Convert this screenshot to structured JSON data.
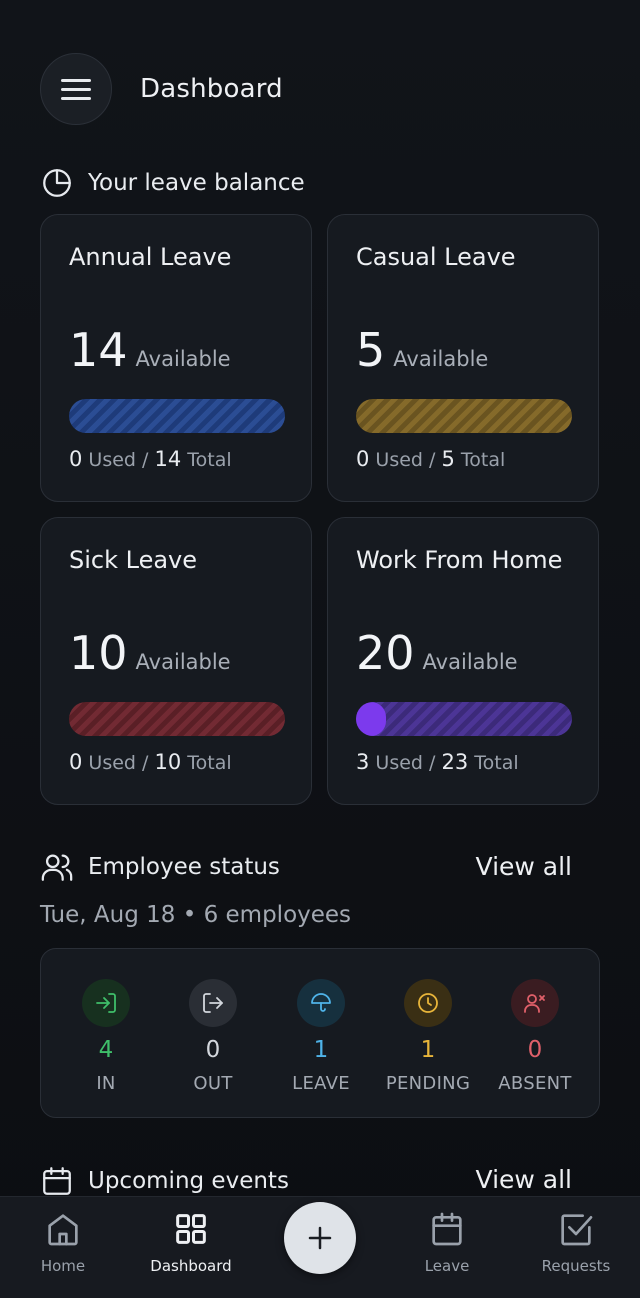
{
  "header": {
    "title": "Dashboard"
  },
  "leave_section": {
    "title": "Your leave balance"
  },
  "leave_cards": [
    {
      "title": "Annual Leave",
      "available": "14",
      "available_label": "Available",
      "used": "0",
      "used_label": "Used",
      "sep": "/",
      "total": "14",
      "total_label": "Total",
      "used_fraction": 0,
      "color": "#2b4d94"
    },
    {
      "title": "Casual Leave",
      "available": "5",
      "available_label": "Available",
      "used": "0",
      "used_label": "Used",
      "sep": "/",
      "total": "5",
      "total_label": "Total",
      "used_fraction": 0,
      "color": "#856a2a"
    },
    {
      "title": "Sick Leave",
      "available": "10",
      "available_label": "Available",
      "used": "0",
      "used_label": "Used",
      "sep": "/",
      "total": "10",
      "total_label": "Total",
      "used_fraction": 0,
      "color": "#722a33"
    },
    {
      "title": "Work From Home",
      "available": "20",
      "available_label": "Available",
      "used": "3",
      "used_label": "Used",
      "sep": "/",
      "total": "23",
      "total_label": "Total",
      "used_fraction": 0.13,
      "color": "#7c3aed"
    }
  ],
  "employee_section": {
    "title": "Employee status",
    "view_all": "View all",
    "subline": "Tue, Aug 18 • 6 employees",
    "stats": [
      {
        "label": "IN",
        "count": "4",
        "icon": "login-icon",
        "color": "#3fbf6a"
      },
      {
        "label": "OUT",
        "count": "0",
        "icon": "logout-icon",
        "color": "#c9ced6"
      },
      {
        "label": "LEAVE",
        "count": "1",
        "icon": "umbrella-icon",
        "color": "#4fb3e8"
      },
      {
        "label": "PENDING",
        "count": "1",
        "icon": "clock-icon",
        "color": "#e8b53a"
      },
      {
        "label": "ABSENT",
        "count": "0",
        "icon": "user-x-icon",
        "color": "#e0606a"
      }
    ]
  },
  "events_section": {
    "title": "Upcoming events",
    "view_all": "View all"
  },
  "bottom_nav": {
    "items": [
      {
        "label": "Home",
        "icon": "home-icon"
      },
      {
        "label": "Dashboard",
        "icon": "grid-icon",
        "active": true
      },
      {
        "label": "Leave",
        "icon": "calendar-icon"
      },
      {
        "label": "Requests",
        "icon": "checkbox-icon"
      }
    ],
    "fab_icon": "plus-icon"
  }
}
